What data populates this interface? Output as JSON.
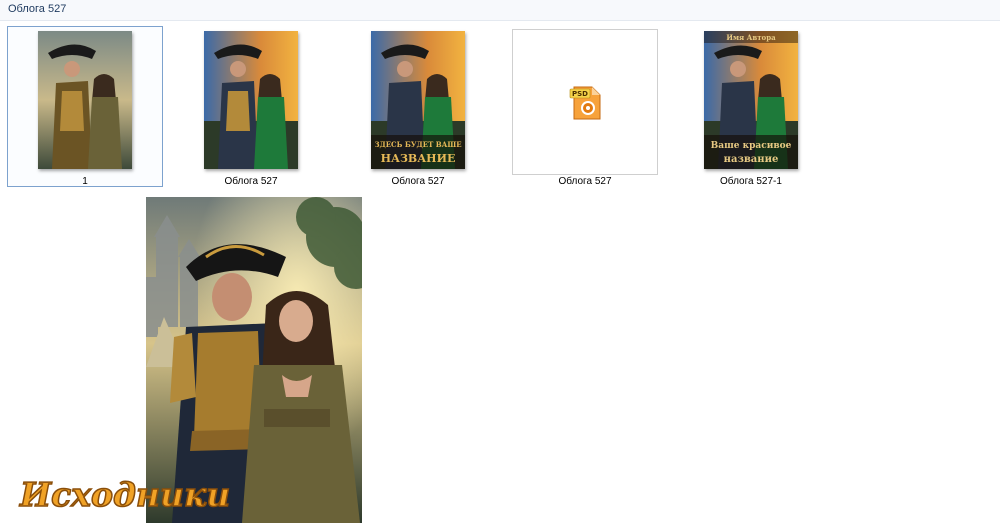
{
  "header": {
    "breadcrumb": "Облога 527"
  },
  "files": [
    {
      "label": "1",
      "selected": true,
      "kind": "image"
    },
    {
      "label": "Облога  527",
      "kind": "image"
    },
    {
      "label": "Облога 527",
      "kind": "image-with-title",
      "title_top": "ЗДЕСЬ БУДЕТ ВАШЕ",
      "title_bottom": "НАЗВАНИЕ"
    },
    {
      "label": "Облога 527",
      "kind": "psd-file",
      "icon_text": "PSD"
    },
    {
      "label": "Облога 527-1",
      "kind": "image-with-title",
      "author": "Имя Автора",
      "title_top": "Ваше красивое",
      "title_bottom": "название"
    }
  ],
  "watermark": {
    "text": "Исходники"
  },
  "colors": {
    "selection_border": "#7da2ce",
    "psd_orange": "#f28c1c",
    "gold": "#d9a441"
  }
}
